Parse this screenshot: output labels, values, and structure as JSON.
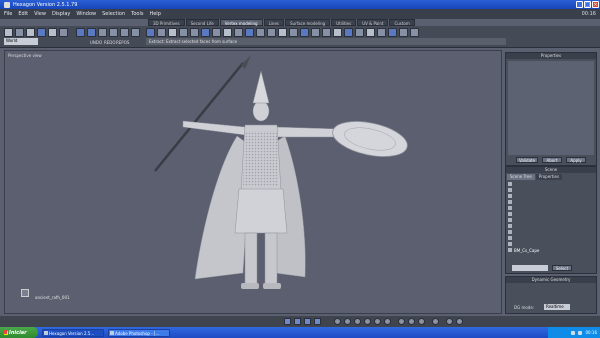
{
  "window": {
    "title": "Hexagon Version 2.5.1.79",
    "clock": "00:16"
  },
  "menu": [
    "File",
    "Edit",
    "View",
    "Display",
    "Window",
    "Selection",
    "Tools",
    "Help"
  ],
  "tabs": [
    {
      "label": "3D Primitives",
      "active": false
    },
    {
      "label": "Second Life",
      "active": false
    },
    {
      "label": "Vertex modeling",
      "active": true
    },
    {
      "label": "Lines",
      "active": false
    },
    {
      "label": "Surface modeling",
      "active": false
    },
    {
      "label": "Utilities",
      "active": false
    },
    {
      "label": "UV & Paint",
      "active": false
    },
    {
      "label": "Custom",
      "active": false
    }
  ],
  "toolbar": {
    "select_mode": "World",
    "labels": [
      "UNDO",
      "REDO",
      "REPOS"
    ],
    "hint": "Extract: Extract selected faces from surface"
  },
  "viewport": {
    "label": "Perspective view",
    "object_label": "ancient_rafh_001"
  },
  "properties_panel": {
    "title": "Properties",
    "buttons": [
      "Validate",
      "Abort",
      "Apply"
    ]
  },
  "scene_panel": {
    "title": "Scene",
    "tabs": [
      {
        "label": "Scene Tree",
        "active": true
      },
      {
        "label": "Properties",
        "active": false
      }
    ],
    "rows": [
      "",
      "",
      "",
      "",
      "",
      "",
      "",
      "",
      "",
      "",
      "",
      "",
      "",
      "",
      "BM_Cs_Cape"
    ],
    "button": "Select"
  },
  "dynamic_geometry": {
    "title": "Dynamic Geometry",
    "mode_label": "DG mode:",
    "mode_value": "Realtime"
  },
  "taskbar": {
    "start": "Iniciar",
    "tasks": [
      {
        "label": "Hexagon Version 2.5...",
        "active": true
      },
      {
        "label": "Adobe Photoshop - [...",
        "active": false
      }
    ],
    "clock": "00:16"
  }
}
